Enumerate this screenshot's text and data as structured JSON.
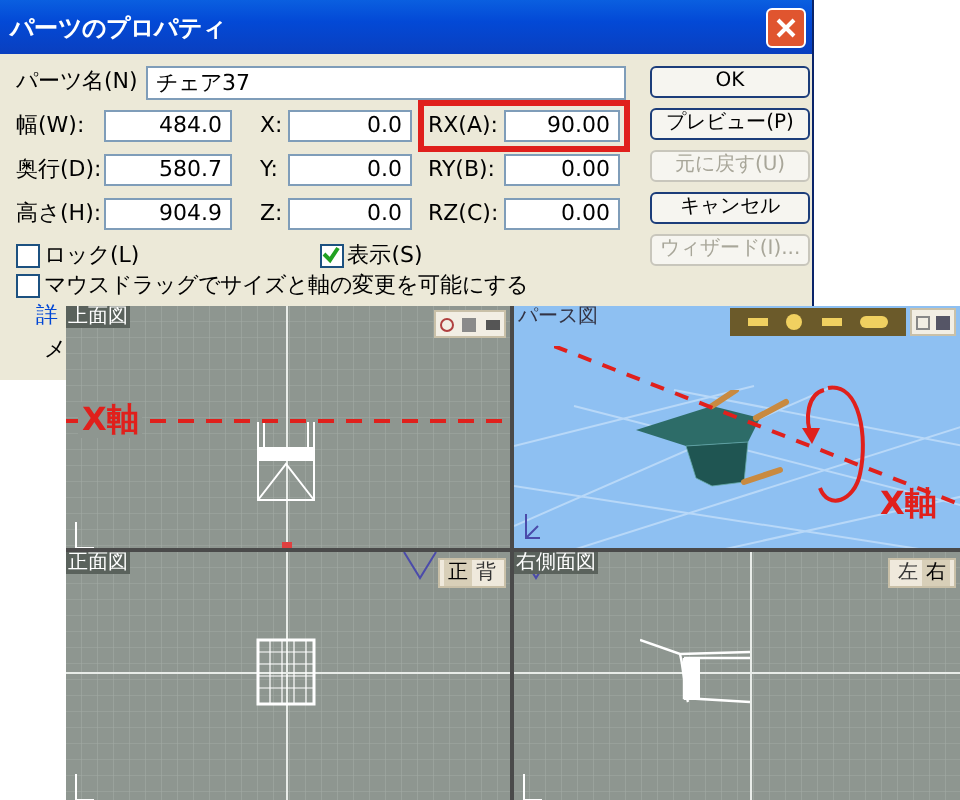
{
  "window": {
    "title": "パーツのプロパティ"
  },
  "name_field": {
    "label": "パーツ名(N)",
    "value": "チェア37"
  },
  "rows": [
    {
      "size": {
        "label": "幅(W):",
        "value": "484.0"
      },
      "position": {
        "label": "X:",
        "value": "0.0"
      },
      "rotation": {
        "label": "RX(A):",
        "value": "90.00",
        "highlighted": true
      }
    },
    {
      "size": {
        "label": "奥行(D):",
        "value": "580.7"
      },
      "position": {
        "label": "Y:",
        "value": "0.0"
      },
      "rotation": {
        "label": "RY(B):",
        "value": "0.00",
        "highlighted": false
      }
    },
    {
      "size": {
        "label": "高さ(H):",
        "value": "904.9"
      },
      "position": {
        "label": "Z:",
        "value": "0.0"
      },
      "rotation": {
        "label": "RZ(C):",
        "value": "0.00",
        "highlighted": false
      }
    }
  ],
  "buttons": [
    {
      "label": "OK",
      "disabled": false
    },
    {
      "label": "プレビュー(P)",
      "disabled": false
    },
    {
      "label": "元に戻す(U)",
      "disabled": true
    },
    {
      "label": "キャンセル",
      "disabled": false
    },
    {
      "label": "ウィザード(I)...",
      "disabled": true
    }
  ],
  "checkboxes": [
    {
      "label": "ロック(L)",
      "checked": false
    },
    {
      "label": "表示(S)",
      "checked": true
    },
    {
      "label": "マウスドラッグでサイズと軸の変更を可能にする",
      "checked": false
    }
  ],
  "group_label": "詳",
  "group_text": "メ",
  "viewports": [
    {
      "kind": "top",
      "title": "上面図",
      "annotation": "X軸"
    },
    {
      "kind": "perspective",
      "title": "パース図",
      "annotation": "X軸"
    },
    {
      "kind": "front",
      "title": "正面図",
      "buttons": [
        {
          "label": "正",
          "selected": true
        },
        {
          "label": "背",
          "selected": false
        }
      ]
    },
    {
      "kind": "side",
      "title": "右側面図",
      "buttons": [
        {
          "label": "左",
          "selected": false
        },
        {
          "label": "右",
          "selected": true
        }
      ]
    }
  ]
}
